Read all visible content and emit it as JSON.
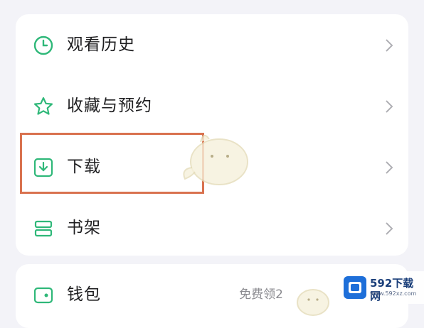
{
  "menu": {
    "items": [
      {
        "label": "观看历史",
        "icon": "clock-icon"
      },
      {
        "label": "收藏与预约",
        "icon": "star-icon"
      },
      {
        "label": "下载",
        "icon": "download-icon"
      },
      {
        "label": "书架",
        "icon": "bookshelf-icon"
      }
    ],
    "wallet": {
      "label": "钱包",
      "icon": "wallet-icon",
      "extra": "免费领2"
    }
  },
  "watermark": {
    "brand": "592下载网",
    "url": "www.592xz.com"
  },
  "colors": {
    "accent_green": "#2fb879",
    "highlight": "#d9724f",
    "logo_blue": "#1e6fd9"
  }
}
